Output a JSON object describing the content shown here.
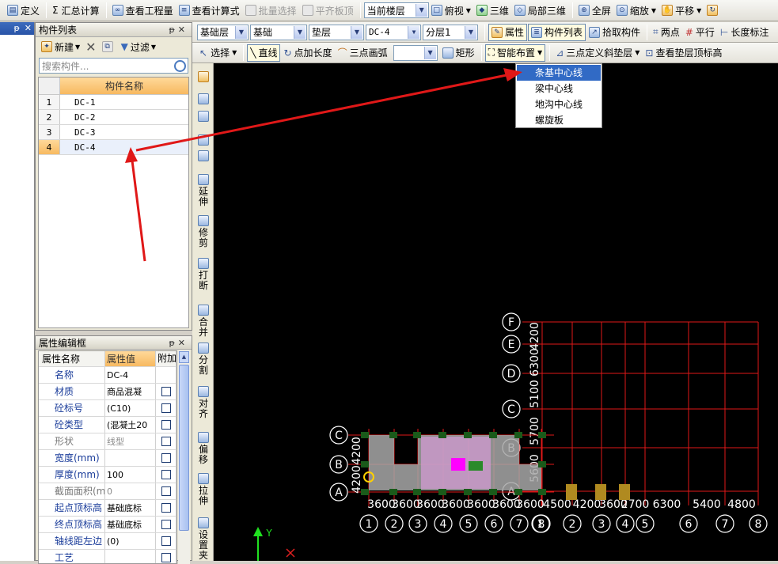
{
  "toolbar_main": {
    "items": [
      {
        "label": "定义",
        "icon": "table-icon",
        "disabled": false
      },
      {
        "label": "汇总计算",
        "icon": "sigma-icon",
        "disabled": false
      },
      {
        "label": "查看工程量",
        "icon": "quantity-icon",
        "disabled": false
      },
      {
        "label": "查看计算式",
        "icon": "formula-icon",
        "disabled": false
      },
      {
        "label": "批量选择",
        "icon": "batch-select-icon",
        "disabled": true
      },
      {
        "label": "平齐板顶",
        "icon": "align-slab-icon",
        "disabled": true
      }
    ],
    "floor_combo": "当前楼层",
    "view_items": [
      {
        "label": "俯视",
        "icon": "top-view-icon"
      },
      {
        "label": "三维",
        "icon": "3d-icon"
      },
      {
        "label": "局部三维",
        "icon": "local-3d-icon"
      },
      {
        "label": "全屏",
        "icon": "fullscreen-icon"
      },
      {
        "label": "缩放",
        "icon": "zoom-icon"
      },
      {
        "label": "平移",
        "icon": "pan-icon"
      }
    ]
  },
  "toolbar_layer": {
    "combos": [
      "基础层",
      "基础",
      "垫层",
      "DC-4",
      "分层1"
    ],
    "buttons": [
      {
        "label": "属性",
        "icon": "property-icon"
      },
      {
        "label": "构件列表",
        "icon": "component-list-icon"
      },
      {
        "label": "拾取构件",
        "icon": "pick-icon"
      },
      {
        "label": "两点",
        "icon": "two-point-icon"
      },
      {
        "label": "平行",
        "icon": "parallel-icon"
      },
      {
        "label": "长度标注",
        "icon": "length-dim-icon"
      }
    ]
  },
  "toolbar_draw": {
    "select": "选择",
    "line": "直线",
    "point_length": "点加长度",
    "arc": "三点画弧",
    "rect": "矩形",
    "smart": "智能布置",
    "slope": "三点定义斜垫层",
    "top_elev": "查看垫层顶标高"
  },
  "left_strip": {
    "title": "ㄨ"
  },
  "component_list": {
    "title": "构件列表",
    "new_label": "新建",
    "filter_label": "过滤",
    "search_placeholder": "搜索构件...",
    "column_header": "构件名称",
    "rows": [
      {
        "num": "1",
        "name": "DC-1"
      },
      {
        "num": "2",
        "name": "DC-2"
      },
      {
        "num": "3",
        "name": "DC-3"
      },
      {
        "num": "4",
        "name": "DC-4"
      }
    ],
    "selected_index": 3
  },
  "property_editor": {
    "title": "属性编辑框",
    "headers": {
      "name": "属性名称",
      "value": "属性值",
      "extra": "附加"
    },
    "rows": [
      {
        "name": "名称",
        "value": "DC-4",
        "checkbox": false,
        "muted": false
      },
      {
        "name": "材质",
        "value": "商品混凝",
        "checkbox": true,
        "muted": false
      },
      {
        "name": "砼标号",
        "value": "(C10)",
        "checkbox": true,
        "muted": false
      },
      {
        "name": "砼类型",
        "value": "(混凝土20",
        "checkbox": true,
        "muted": false
      },
      {
        "name": "形状",
        "value": "线型",
        "checkbox": true,
        "muted": true
      },
      {
        "name": "宽度(mm)",
        "value": "",
        "checkbox": true,
        "muted": false
      },
      {
        "name": "厚度(mm)",
        "value": "100",
        "checkbox": true,
        "muted": false
      },
      {
        "name": "截面面积(m",
        "value": "0",
        "checkbox": true,
        "muted": true
      },
      {
        "name": "起点顶标高",
        "value": "基础底标",
        "checkbox": true,
        "muted": false
      },
      {
        "name": "终点顶标高",
        "value": "基础底标",
        "checkbox": true,
        "muted": false
      },
      {
        "name": "轴线距左边",
        "value": "(0)",
        "checkbox": true,
        "muted": false
      },
      {
        "name": "工艺",
        "value": "",
        "checkbox": true,
        "muted": false
      }
    ]
  },
  "vertical_tools": [
    "延伸",
    "修剪",
    "打断",
    "合并",
    "分割",
    "对齐",
    "偏移",
    "拉伸",
    "设置夹"
  ],
  "smart_menu": {
    "items": [
      "条基中心线",
      "梁中心线",
      "地沟中心线",
      "螺旋板"
    ],
    "highlighted_index": 0
  },
  "cad": {
    "right_grid_rows": [
      "F",
      "E",
      "D",
      "C",
      "B",
      "A"
    ],
    "right_grid_cols": [
      "1",
      "2",
      "3",
      "4",
      "5",
      "6",
      "7",
      "8"
    ],
    "right_grid_dims_x": [
      "4500",
      "4200",
      "3600",
      "2700",
      "6300",
      "5400",
      "4800"
    ],
    "right_grid_dims_y": [
      "4200",
      "6300",
      "5100",
      "5700",
      "5600"
    ],
    "left_rows": [
      "C",
      "B",
      "A"
    ],
    "left_cols": [
      "1",
      "2",
      "3",
      "4",
      "5",
      "6",
      "7",
      "8"
    ],
    "left_dims_x": [
      "3600",
      "3600",
      "3600",
      "3600",
      "3600",
      "3600",
      "3600"
    ],
    "left_dims_y": [
      "4200",
      "4200"
    ],
    "axis_y_label": "Y",
    "colors": {
      "grid": "#e01818",
      "bubble": "#ffffff",
      "pad": "#1a5a1a",
      "arrow": "#e01818"
    }
  }
}
